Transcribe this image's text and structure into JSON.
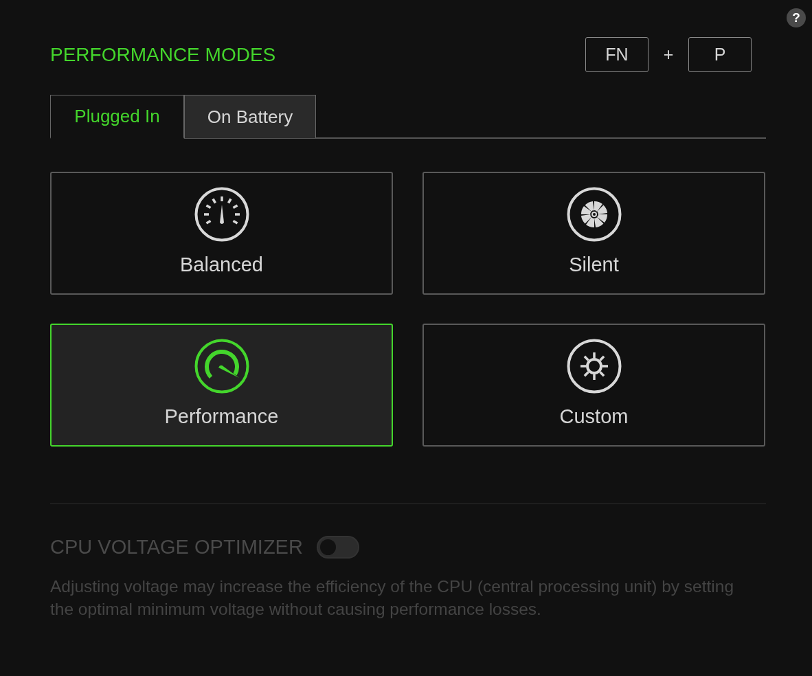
{
  "help_button": "?",
  "title": "PERFORMANCE MODES",
  "shortcut": {
    "keys": [
      "FN",
      "P"
    ],
    "separator": "+"
  },
  "tabs": [
    {
      "label": "Plugged In",
      "selected": true
    },
    {
      "label": "On Battery",
      "selected": false
    }
  ],
  "modes": [
    {
      "kind": "balanced",
      "label": "Balanced",
      "selected": false
    },
    {
      "kind": "silent",
      "label": "Silent",
      "selected": false
    },
    {
      "kind": "performance",
      "label": "Performance",
      "selected": true
    },
    {
      "kind": "custom",
      "label": "Custom",
      "selected": false
    }
  ],
  "cpu_voltage_optimizer": {
    "label": "CPU VOLTAGE OPTIMIZER",
    "on": false,
    "disabled": true,
    "description": "Adjusting voltage may increase the efficiency of the CPU (central processing unit) by setting the optimal minimum voltage without causing performance losses."
  }
}
